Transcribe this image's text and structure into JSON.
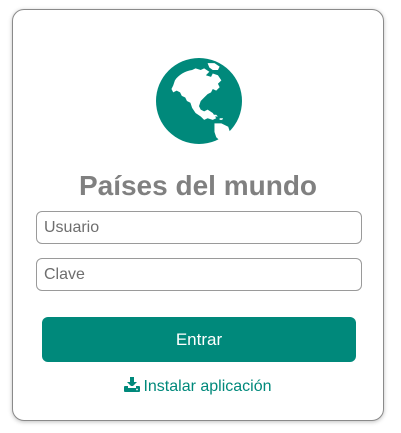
{
  "app": {
    "title": "Países del mundo",
    "logo_icon": "globe-americas-icon",
    "accent_color": "#00897b"
  },
  "login_form": {
    "username_placeholder": "Usuario",
    "password_placeholder": "Clave",
    "submit_label": "Entrar"
  },
  "install": {
    "icon": "download-icon",
    "label": "Instalar aplicación"
  }
}
